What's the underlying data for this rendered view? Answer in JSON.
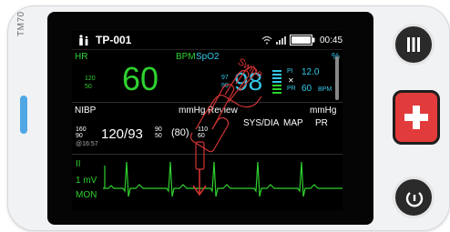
{
  "device": {
    "model": "TM70"
  },
  "status": {
    "patient_id": "TP-001",
    "time": "00:45"
  },
  "hr": {
    "label": "HR",
    "unit": "BPM",
    "value": "60",
    "upper": "120",
    "lower": "50"
  },
  "spo2": {
    "label": "SpO2",
    "unit": "%",
    "value": "98",
    "upper": "97",
    "lower": "90",
    "pi_label": "PI",
    "pi_value": "12.0",
    "pr_label": "PR",
    "pr_value": "60",
    "pr_unit": "BPM",
    "swipe_label": "Swipe"
  },
  "nibp": {
    "label": "NIBP",
    "unit": "mmHg",
    "upper": "160",
    "lower": "90",
    "upper2": "90",
    "lower2": "50",
    "upper3": "110",
    "lower3": "60",
    "time": "@16:57",
    "value": "120/93",
    "map": "(80)",
    "review_label": "Review",
    "sysdia_label": "SYS/DIA",
    "map_label": "MAP",
    "unit2": "mmHg",
    "pr_label": "PR"
  },
  "ecg": {
    "lead": "II",
    "scale": "1 mV",
    "mode": "MON"
  },
  "colors": {
    "hr_green": "#2fd12f",
    "spo2_cyan": "#33c8e8",
    "alarm_red": "#e23b3b",
    "side_blue": "#4fa7e3"
  }
}
